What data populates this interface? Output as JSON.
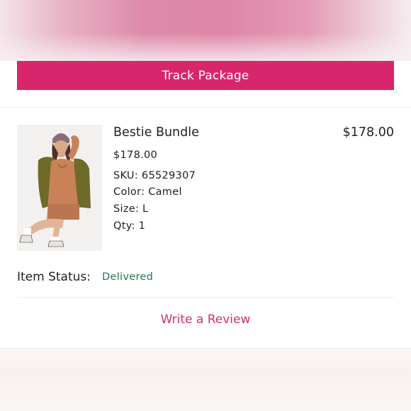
{
  "header": {
    "track_button_label": "Track Package"
  },
  "item": {
    "name": "Bestie Bundle",
    "price_total": "$178.00",
    "price_unit": "$178.00",
    "sku": "SKU: 65529307",
    "color": "Color: Camel",
    "size": "Size: L",
    "qty": "Qty: 1",
    "image_icon": "product-photo"
  },
  "status": {
    "label": "Item Status:",
    "value": "Delivered"
  },
  "actions": {
    "review_label": "Write a Review"
  },
  "colors": {
    "accent": "#d7266c",
    "delivered": "#1c7a4a",
    "review_link": "#d1306f"
  }
}
